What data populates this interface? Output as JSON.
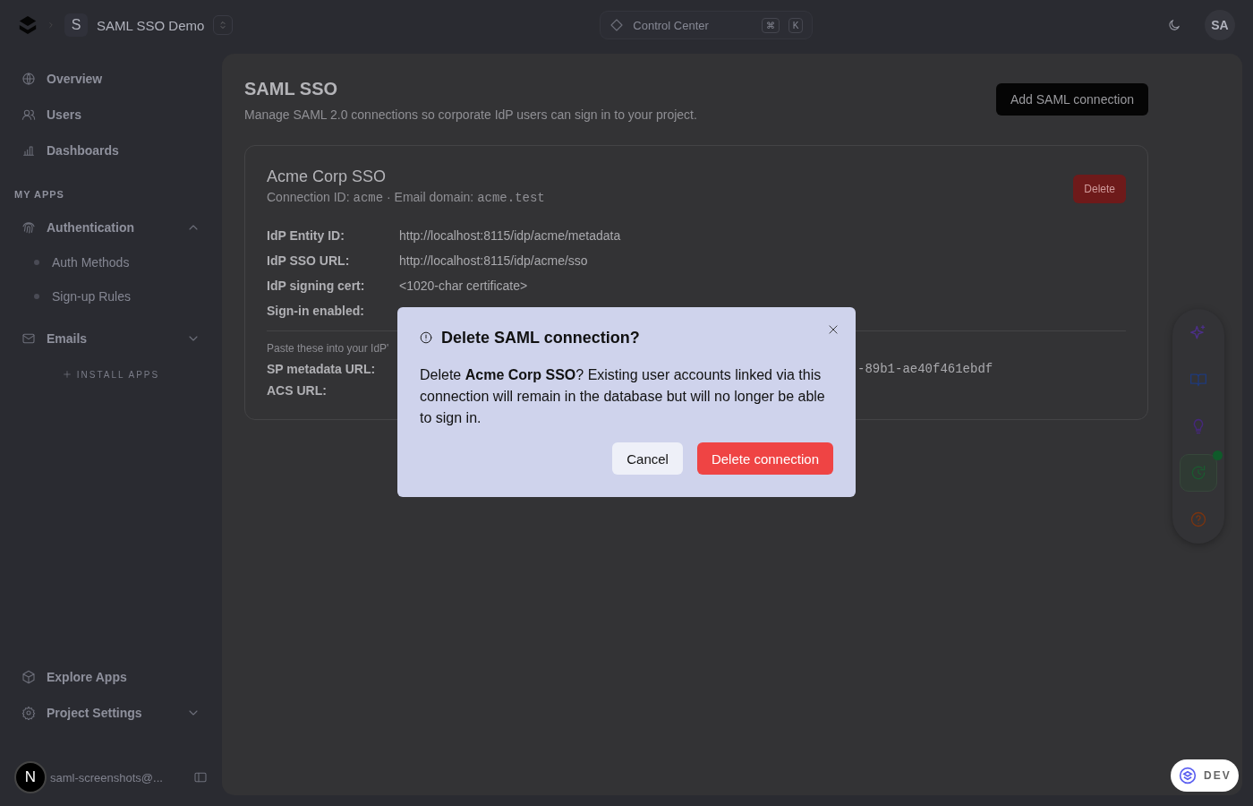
{
  "topbar": {
    "project_initial": "S",
    "project_name": "SAML SSO Demo",
    "search": {
      "placeholder": "Control Center",
      "keys": [
        "⌘",
        "K"
      ]
    },
    "avatar": "SA"
  },
  "sidebar": {
    "items": [
      {
        "label": "Overview"
      },
      {
        "label": "Users"
      },
      {
        "label": "Dashboards"
      }
    ],
    "section": "MY APPS",
    "apps": [
      {
        "label": "Authentication",
        "expanded": true,
        "children": [
          {
            "label": "Auth Methods"
          },
          {
            "label": "Sign-up Rules"
          }
        ]
      },
      {
        "label": "Emails",
        "expanded": false
      }
    ],
    "install": "INSTALL APPS",
    "bottom": [
      {
        "label": "Explore Apps"
      },
      {
        "label": "Project Settings",
        "expanded": false
      }
    ],
    "user": {
      "initial": "N",
      "email": "saml-screenshots@..."
    }
  },
  "page": {
    "title": "SAML SSO",
    "subtitle": "Manage SAML 2.0 connections so corporate IdP users can sign in to your project.",
    "add_button": "Add SAML connection",
    "connection": {
      "name": "Acme Corp SSO",
      "id_label": "Connection ID:",
      "id": "acme",
      "separator": "·",
      "domain_label": "Email domain:",
      "domain": "acme.test",
      "delete_button": "Delete",
      "fields": [
        {
          "label": "IdP Entity ID:",
          "value": "http://localhost:8115/idp/acme/metadata"
        },
        {
          "label": "IdP SSO URL:",
          "value": "http://localhost:8115/idp/acme/sso"
        },
        {
          "label": "IdP signing cert:",
          "value": "<1020-char certificate>"
        },
        {
          "label": "Sign-in enabled:"
        }
      ],
      "note": "Paste these into your IdP'",
      "sp_fields": [
        {
          "label": "SP metadata URL:",
          "value": "-89b1-ae40f461ebdf"
        },
        {
          "label": "ACS URL:"
        }
      ]
    }
  },
  "tools": [
    {
      "selected": false,
      "notify": false
    },
    {
      "selected": false,
      "notify": false
    },
    {
      "selected": false,
      "notify": false
    },
    {
      "selected": true,
      "notify": true
    },
    {
      "selected": false,
      "notify": false
    }
  ],
  "dialog": {
    "title": "Delete SAML connection?",
    "body": "Delete **Acme Corp SSO**? Existing user accounts linked via this connection will remain in the database but will no longer be able to sign in.",
    "buttons": [
      {
        "label": "Cancel",
        "kind": "secondary"
      },
      {
        "label": "Delete connection",
        "kind": "danger"
      }
    ]
  },
  "env_badge": "DEV"
}
